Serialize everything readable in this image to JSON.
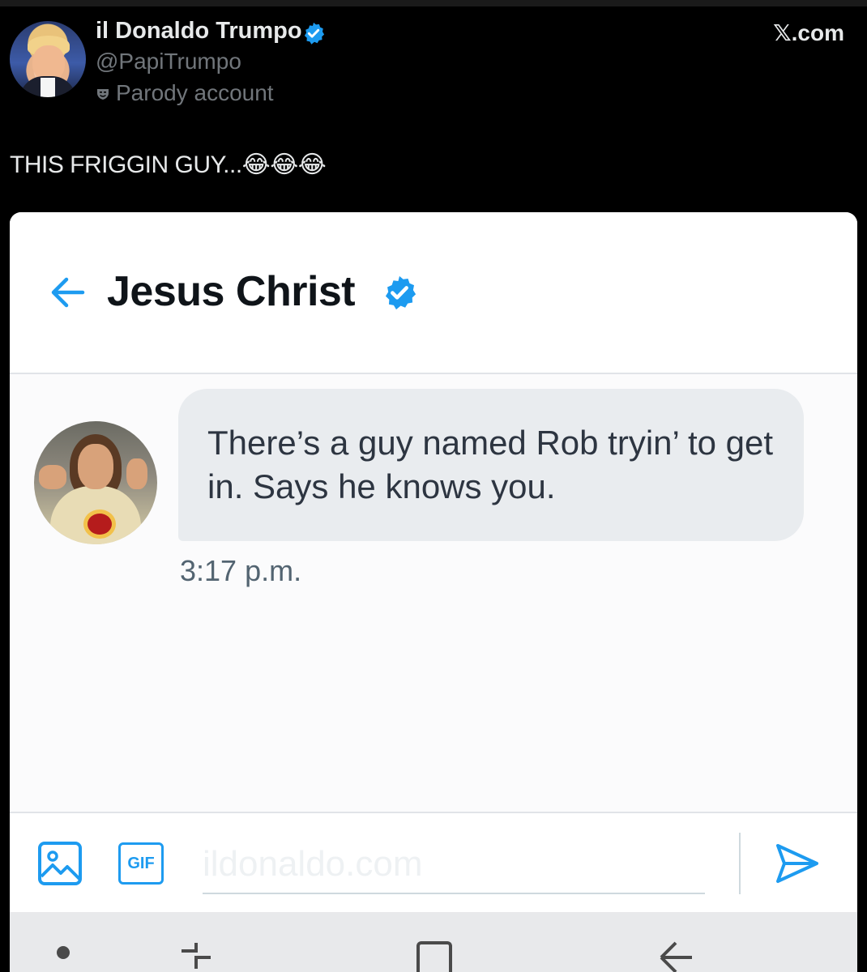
{
  "post": {
    "author_name": "il Donaldo Trumpo",
    "author_handle": "@PapiTrumpo",
    "parody_label": "Parody account",
    "watermark": "𝕏.com",
    "text": "THIS FRIGGIN GUY...😂😂😂"
  },
  "dm": {
    "contact_name": "Jesus Christ",
    "message": "There’s a guy named Rob tryin’ to get in. Says he knows you.",
    "time": "3:17 p.m."
  },
  "composer": {
    "gif_label": "GIF",
    "placeholder": "ildonaldo.com"
  },
  "colors": {
    "accent": "#1d9bf0",
    "bubble": "#e9ecef",
    "background": "#000000"
  },
  "icons": [
    "verified-badge-icon",
    "parody-mask-icon",
    "back-arrow-icon",
    "image-icon",
    "gif-icon",
    "send-icon",
    "nav-dot-icon",
    "recents-icon",
    "home-icon",
    "back-nav-icon"
  ]
}
